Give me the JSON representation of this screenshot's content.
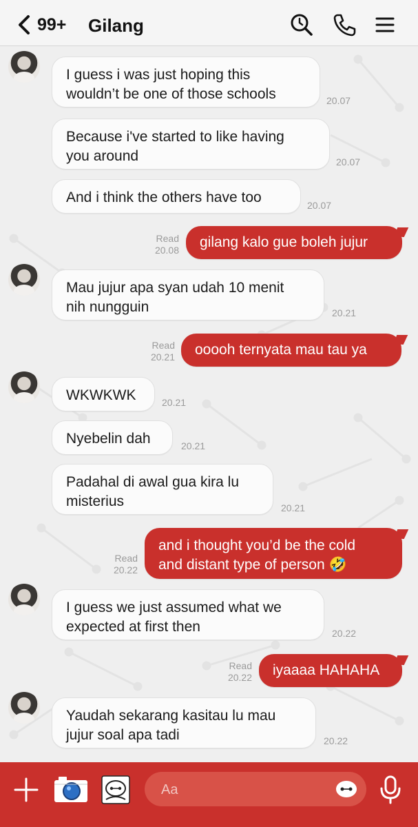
{
  "header": {
    "unread_count": "99+",
    "contact_name": "Gilang"
  },
  "colors": {
    "accent": "#c9302c",
    "incoming_bubble": "#fbfbfb",
    "background": "#efefef"
  },
  "messages": [
    {
      "dir": "in",
      "text": "I guess i was just hoping this\nwouldn’t be one of those schools",
      "time": "20.07"
    },
    {
      "dir": "in",
      "text": "Because i've started to like having\nyou around",
      "time": "20.07"
    },
    {
      "dir": "in",
      "text": "And i think the others have too",
      "time": "20.07"
    },
    {
      "dir": "out",
      "text": "gilang kalo gue boleh jujur",
      "read": "Read",
      "time": "20.08"
    },
    {
      "dir": "in",
      "text": "Mau jujur apa syan udah 10 menit\nnih nungguin",
      "time": "20.21"
    },
    {
      "dir": "out",
      "text": "ooooh ternyata mau tau ya",
      "read": "Read",
      "time": "20.21"
    },
    {
      "dir": "in",
      "text": "WKWKWK",
      "time": "20.21"
    },
    {
      "dir": "in",
      "text": "Nyebelin dah",
      "time": "20.21"
    },
    {
      "dir": "in",
      "text": "Padahal di awal gua kira lu\nmisterius",
      "time": "20.21"
    },
    {
      "dir": "out",
      "text": "and i thought you’d be the cold\nand distant type of person 🤣",
      "read": "Read",
      "time": "20.22"
    },
    {
      "dir": "in",
      "text": "I guess we just assumed what we\nexpected at first then",
      "time": "20.22"
    },
    {
      "dir": "out",
      "text": "iyaaaa HAHAHA",
      "read": "Read",
      "time": "20.22"
    },
    {
      "dir": "in",
      "text": "Yaudah sekarang kasitau lu mau\njujur soal apa tadi",
      "time": "20.22"
    }
  ],
  "composer": {
    "placeholder": "Aa"
  },
  "icons": {
    "back": "chevron-left-icon",
    "search": "search-icon",
    "call": "phone-icon",
    "menu": "menu-icon",
    "plus": "plus-icon",
    "camera": "camera-icon",
    "album": "image-album-icon",
    "emoji": "emoji-icon",
    "voice": "microphone-icon"
  }
}
